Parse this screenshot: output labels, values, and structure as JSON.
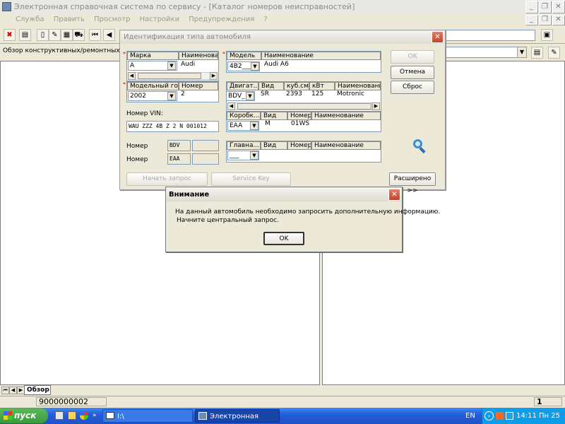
{
  "window": {
    "title": "Электронная справочная система по сервису - [Каталог  номеров  неисправностей]"
  },
  "menu": [
    "Служба",
    "Править",
    "Просмотр",
    "Настройки",
    "Предупреждения",
    "?"
  ],
  "overview_label": "Обзор конструктивных/ремонтных груп",
  "tabs": {
    "overview": "Обзор"
  },
  "status": {
    "left": "9000000002",
    "right": "1"
  },
  "taskbar": {
    "start": "пуск",
    "task1": "I:\\",
    "task2": "Электронная справ...",
    "lang": "EN",
    "clock": "14:11 Пн 25"
  },
  "dialog": {
    "title": "Идентификация типа автомобиля",
    "brand": {
      "h1": "Марка",
      "h2": "Наименование",
      "value": "A",
      "name": "Audi"
    },
    "year": {
      "h1": "Модельный год",
      "h2": "Номер",
      "value": "2002",
      "num": "2"
    },
    "vin": {
      "label": "Номер VIN:",
      "value": "WAU ZZZ 4B Z 2 N 001012"
    },
    "model": {
      "h1": "Модель",
      "h2": "Наименование",
      "value": "4B2___",
      "name": "Audi A6"
    },
    "engine": {
      "h1": "Двигат...",
      "h2": "Вид",
      "h3": "куб.см",
      "h4": "кВт",
      "h5": "Наименование",
      "value": "BDV_",
      "kind": "SR",
      "cc": "2393",
      "kw": "125",
      "name": "Motronic"
    },
    "gearbox": {
      "h1": "Коробк...",
      "h2": "Вид",
      "h3": "Номер",
      "h4": "Наименование",
      "value": "EAA",
      "kind": "M",
      "num": "01WS"
    },
    "final": {
      "h1": "Главна...",
      "h2": "Вид",
      "h3": "Номер",
      "h4": "Наименование",
      "value": "___"
    },
    "nomer_label": "Номер",
    "nomer1": "BDV",
    "nomer2": "EAA",
    "buttons": {
      "ok": "OK",
      "cancel": "Отмена",
      "reset": "Сброс",
      "start": "Начать запрос",
      "service": "Service Key",
      "extended": "Расширено >>"
    }
  },
  "alert": {
    "title": "Внимание",
    "line1": "На  данный автомобиль необходимо запросить дополнительную информацию.",
    "line2": "Начните центральный запрос.",
    "ok": "OK"
  }
}
